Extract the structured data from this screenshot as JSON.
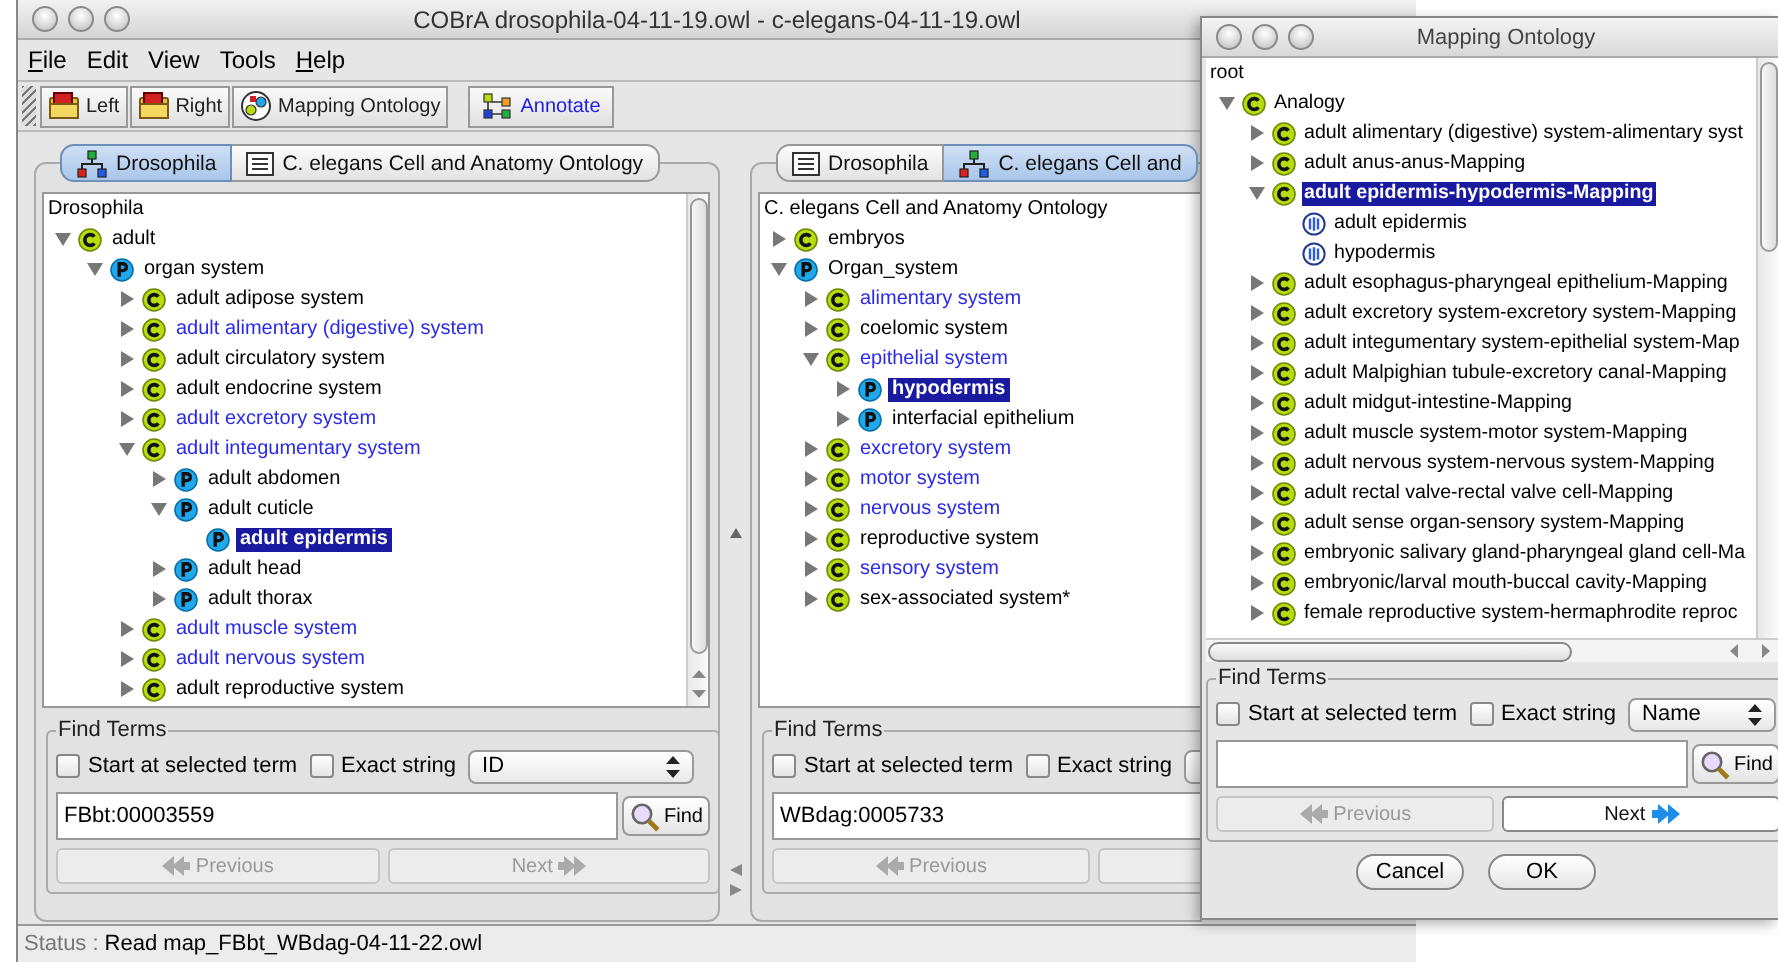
{
  "window": {
    "title": "COBrA  drosophila-04-11-19.owl - c-elegans-04-11-19.owl"
  },
  "menu": [
    {
      "label": "File",
      "mnemonic": true
    },
    {
      "label": "Edit",
      "mnemonic": false
    },
    {
      "label": "View",
      "mnemonic": false
    },
    {
      "label": "Tools",
      "mnemonic": false
    },
    {
      "label": "Help",
      "mnemonic": true
    }
  ],
  "toolbar": [
    {
      "label": "Left",
      "kind": "folder"
    },
    {
      "label": "Right",
      "kind": "folder"
    },
    {
      "label": "Mapping Ontology",
      "kind": "mapping"
    },
    {
      "label": "Annotate",
      "kind": "annotate"
    }
  ],
  "panels": [
    {
      "tabs": [
        {
          "label": "Drosophila",
          "selected": true
        },
        {
          "label": "C. elegans Cell and Anatomy Ontology",
          "selected": false
        }
      ],
      "tree": {
        "root": "Drosophila",
        "items": [
          {
            "label": "adult",
            "kind": "class",
            "mapped": false,
            "selected": false,
            "expanded": true,
            "children": [
              {
                "label": "organ system",
                "kind": "property",
                "mapped": false,
                "selected": false,
                "expanded": true,
                "children": [
                  {
                    "label": "adult adipose system",
                    "kind": "class",
                    "mapped": false,
                    "selected": false,
                    "expanded": false
                  },
                  {
                    "label": "adult alimentary (digestive) system",
                    "kind": "class",
                    "mapped": true,
                    "selected": false,
                    "expanded": false
                  },
                  {
                    "label": "adult circulatory system",
                    "kind": "class",
                    "mapped": false,
                    "selected": false,
                    "expanded": false
                  },
                  {
                    "label": "adult endocrine system",
                    "kind": "class",
                    "mapped": false,
                    "selected": false,
                    "expanded": false
                  },
                  {
                    "label": "adult excretory system",
                    "kind": "class",
                    "mapped": true,
                    "selected": false,
                    "expanded": false
                  },
                  {
                    "label": "adult integumentary system",
                    "kind": "class",
                    "mapped": true,
                    "selected": false,
                    "expanded": true,
                    "children": [
                      {
                        "label": "adult abdomen",
                        "kind": "property",
                        "mapped": false,
                        "selected": false,
                        "expanded": false
                      },
                      {
                        "label": "adult cuticle",
                        "kind": "property",
                        "mapped": false,
                        "selected": false,
                        "expanded": true,
                        "children": [
                          {
                            "label": "adult epidermis",
                            "kind": "property",
                            "mapped": false,
                            "selected": true
                          }
                        ]
                      },
                      {
                        "label": "adult head",
                        "kind": "property",
                        "mapped": false,
                        "selected": false,
                        "expanded": false
                      },
                      {
                        "label": "adult thorax",
                        "kind": "property",
                        "mapped": false,
                        "selected": false,
                        "expanded": false
                      }
                    ]
                  },
                  {
                    "label": "adult muscle system",
                    "kind": "class",
                    "mapped": true,
                    "selected": false,
                    "expanded": false
                  },
                  {
                    "label": "adult nervous system",
                    "kind": "class",
                    "mapped": true,
                    "selected": false,
                    "expanded": false
                  },
                  {
                    "label": "adult reproductive system",
                    "kind": "class",
                    "mapped": false,
                    "selected": false,
                    "expanded": false
                  }
                ]
              }
            ]
          }
        ]
      },
      "find": {
        "title": "Find Terms",
        "options": [
          {
            "label": "Start at selected term",
            "checked": false
          },
          {
            "label": "Exact string",
            "checked": false
          }
        ],
        "search_by": "ID",
        "query": "FBbt:00003559",
        "find_button": "Find",
        "previous": {
          "label": "Previous",
          "disabled": true
        },
        "next": {
          "label": "Next",
          "disabled": true
        }
      }
    },
    {
      "tabs": [
        {
          "label": "Drosophila",
          "selected": false
        },
        {
          "label": "C. elegans Cell and",
          "selected": true
        }
      ],
      "tree": {
        "root": "C. elegans Cell and Anatomy Ontology",
        "items": [
          {
            "label": "embryos",
            "kind": "class",
            "mapped": false,
            "selected": false,
            "expanded": false
          },
          {
            "label": "Organ_system",
            "kind": "property",
            "mapped": false,
            "selected": false,
            "expanded": true,
            "children": [
              {
                "label": "alimentary system",
                "kind": "class",
                "mapped": true,
                "selected": false,
                "expanded": false
              },
              {
                "label": "coelomic system",
                "kind": "class",
                "mapped": false,
                "selected": false,
                "expanded": false
              },
              {
                "label": "epithelial system",
                "kind": "class",
                "mapped": true,
                "selected": false,
                "expanded": true,
                "children": [
                  {
                    "label": "hypodermis",
                    "kind": "property",
                    "mapped": false,
                    "selected": true,
                    "expanded": false
                  },
                  {
                    "label": "interfacial epithelium",
                    "kind": "property",
                    "mapped": false,
                    "selected": false,
                    "expanded": false
                  }
                ]
              },
              {
                "label": "excretory system",
                "kind": "class",
                "mapped": true,
                "selected": false,
                "expanded": false
              },
              {
                "label": "motor system",
                "kind": "class",
                "mapped": true,
                "selected": false,
                "expanded": false
              },
              {
                "label": "nervous system",
                "kind": "class",
                "mapped": true,
                "selected": false,
                "expanded": false
              },
              {
                "label": "reproductive system",
                "kind": "class",
                "mapped": false,
                "selected": false,
                "expanded": false
              },
              {
                "label": "sensory system",
                "kind": "class",
                "mapped": true,
                "selected": false,
                "expanded": false
              },
              {
                "label": "sex-associated system*",
                "kind": "class",
                "mapped": false,
                "selected": false,
                "expanded": false
              }
            ]
          }
        ]
      },
      "find": {
        "title": "Find Terms",
        "options": [
          {
            "label": "Start at selected term",
            "checked": false
          },
          {
            "label": "Exact string",
            "checked": false
          }
        ],
        "query": "WBdag:0005733",
        "previous": {
          "label": "Previous",
          "disabled": true
        },
        "next": {
          "disabled": true
        }
      }
    }
  ],
  "status_bar": {
    "label": "Status :",
    "text": "Read map_FBbt_WBdag-04-11-22.owl"
  },
  "dialog": {
    "title": "Mapping Ontology",
    "tree": {
      "root": "root",
      "items": [
        {
          "label": "Analogy",
          "kind": "class",
          "selected": false,
          "expanded": true,
          "children": [
            {
              "label": "adult alimentary (digestive) system-alimentary syst",
              "kind": "class",
              "selected": false,
              "expanded": false
            },
            {
              "label": "adult anus-anus-Mapping",
              "kind": "class",
              "selected": false,
              "expanded": false
            },
            {
              "label": "adult epidermis-hypodermis-Mapping",
              "kind": "class",
              "selected": true,
              "expanded": true,
              "children": [
                {
                  "label": "adult epidermis",
                  "kind": "instance",
                  "selected": false
                },
                {
                  "label": "hypodermis",
                  "kind": "instance",
                  "selected": false
                }
              ]
            },
            {
              "label": "adult esophagus-pharyngeal epithelium-Mapping",
              "kind": "class",
              "selected": false,
              "expanded": false
            },
            {
              "label": "adult excretory system-excretory system-Mapping",
              "kind": "class",
              "selected": false,
              "expanded": false
            },
            {
              "label": "adult integumentary system-epithelial system-Map",
              "kind": "class",
              "selected": false,
              "expanded": false
            },
            {
              "label": "adult Malpighian tubule-excretory canal-Mapping",
              "kind": "class",
              "selected": false,
              "expanded": false
            },
            {
              "label": "adult midgut-intestine-Mapping",
              "kind": "class",
              "selected": false,
              "expanded": false
            },
            {
              "label": "adult muscle system-motor system-Mapping",
              "kind": "class",
              "selected": false,
              "expanded": false
            },
            {
              "label": "adult nervous system-nervous system-Mapping",
              "kind": "class",
              "selected": false,
              "expanded": false
            },
            {
              "label": "adult rectal valve-rectal valve cell-Mapping",
              "kind": "class",
              "selected": false,
              "expanded": false
            },
            {
              "label": "adult sense organ-sensory system-Mapping",
              "kind": "class",
              "selected": false,
              "expanded": false
            },
            {
              "label": "embryonic salivary gland-pharyngeal gland cell-Ma",
              "kind": "class",
              "selected": false,
              "expanded": false
            },
            {
              "label": "embryonic/larval mouth-buccal cavity-Mapping",
              "kind": "class",
              "selected": false,
              "expanded": false
            },
            {
              "label": "female reproductive system-hermaphrodite reproc",
              "kind": "class",
              "selected": false,
              "expanded": false
            }
          ]
        }
      ]
    },
    "find": {
      "title": "Find Terms",
      "options": [
        {
          "label": "Start at selected term",
          "checked": false
        },
        {
          "label": "Exact string",
          "checked": false
        }
      ],
      "search_by": "Name",
      "find_button": "Find",
      "previous": {
        "label": "Previous",
        "disabled": true
      },
      "next": {
        "label": "Next",
        "disabled": false
      }
    },
    "buttons": [
      {
        "label": "Cancel"
      },
      {
        "label": "OK"
      }
    ]
  }
}
